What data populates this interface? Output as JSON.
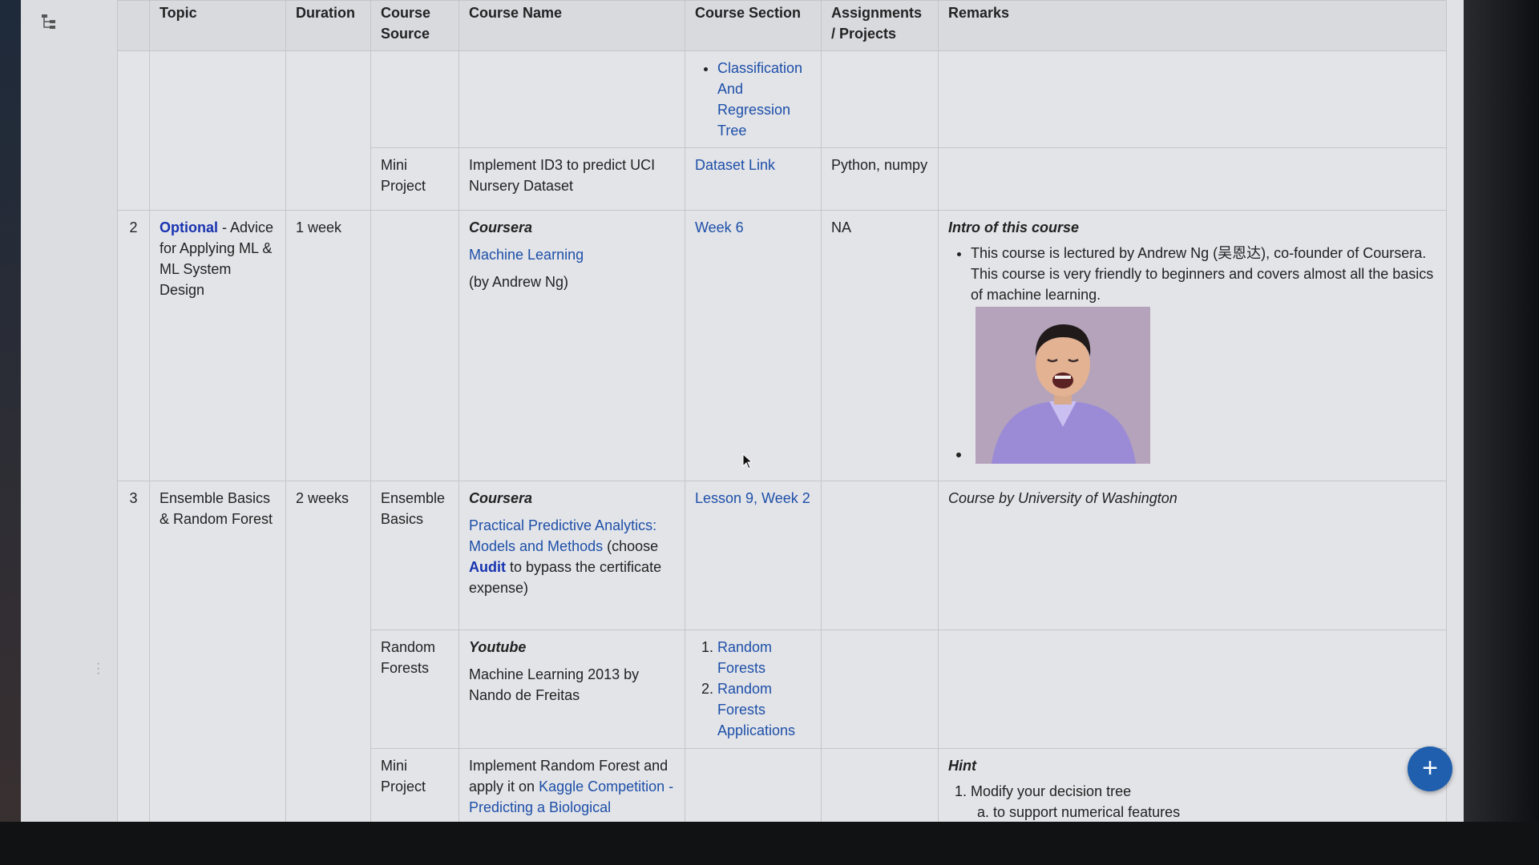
{
  "table": {
    "headers": [
      "Topic",
      "Duration",
      "Course Source",
      "Course Name",
      "Course Section",
      "Assignments / Projects",
      "Remarks"
    ],
    "row1_cont": {
      "section_item": "Classification And Regression Tree"
    },
    "row1_mini": {
      "source": "Mini Project",
      "name": "Implement ID3 to predict UCI Nursery Dataset",
      "section": "Dataset Link",
      "assignments": "Python, numpy"
    },
    "row2": {
      "num": "2",
      "topic_optional": "Optional",
      "topic_rest": " - Advice for Applying ML & ML System Design",
      "duration": "1 week",
      "provider": "Coursera",
      "course_link": "Machine Learning",
      "course_by": "(by Andrew Ng)",
      "section": "Week 6",
      "assignments": "NA",
      "remarks_heading": "Intro of this course",
      "remarks_text": "This course is lectured by Andrew Ng (吴恩达), co-founder of Coursera. This course is very friendly to beginners and covers almost all the basics of machine learning."
    },
    "row3": {
      "num": "3",
      "topic": "Ensemble Basics & Random Forest",
      "duration": "2 weeks",
      "source": "Ensemble Basics",
      "provider": "Coursera",
      "course_link": "Practical Predictive Analytics: Models and Methods",
      "choose": " (choose ",
      "audit": "Audit",
      "choose_rest": " to bypass the certificate expense)",
      "section": "Lesson 9, Week 2",
      "remarks": "Course by University of Washington"
    },
    "row3_rf": {
      "source": "Random Forests",
      "provider": "Youtube",
      "name": "Machine Learning 2013 by Nando de Freitas",
      "sections": [
        "Random Forests",
        "Random Forests Applications"
      ]
    },
    "row3_mini": {
      "source": "Mini Project",
      "name_pre": "Implement Random Forest and apply it on ",
      "name_link": "Kaggle Competition - Predicting a Biological Response",
      "hint": "Hint",
      "hint_item": "Modify your decision tree",
      "hint_sub": "to support numerical features"
    }
  },
  "fab_label": "+",
  "colors": {
    "link": "#1d4fa8",
    "accent": "#1833b0",
    "fab": "#1f5fae"
  },
  "icons": [
    "tree-view-icon",
    "plus-icon",
    "cursor-icon",
    "drag-handle-icon"
  ]
}
